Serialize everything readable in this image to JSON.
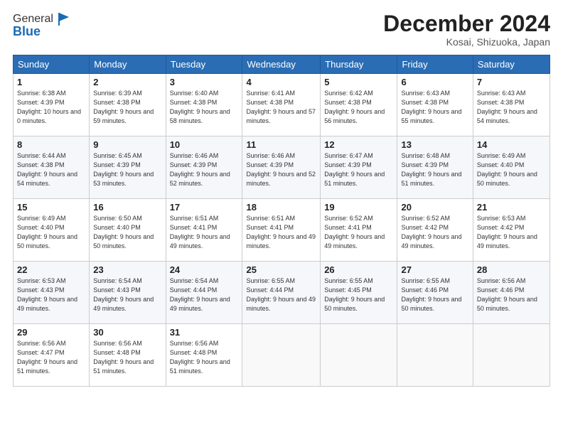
{
  "header": {
    "logo_general": "General",
    "logo_blue": "Blue",
    "month_title": "December 2024",
    "location": "Kosai, Shizuoka, Japan"
  },
  "days_of_week": [
    "Sunday",
    "Monday",
    "Tuesday",
    "Wednesday",
    "Thursday",
    "Friday",
    "Saturday"
  ],
  "weeks": [
    [
      {
        "day": "1",
        "sunrise": "6:38 AM",
        "sunset": "4:39 PM",
        "daylight": "10 hours and 0 minutes."
      },
      {
        "day": "2",
        "sunrise": "6:39 AM",
        "sunset": "4:38 PM",
        "daylight": "9 hours and 59 minutes."
      },
      {
        "day": "3",
        "sunrise": "6:40 AM",
        "sunset": "4:38 PM",
        "daylight": "9 hours and 58 minutes."
      },
      {
        "day": "4",
        "sunrise": "6:41 AM",
        "sunset": "4:38 PM",
        "daylight": "9 hours and 57 minutes."
      },
      {
        "day": "5",
        "sunrise": "6:42 AM",
        "sunset": "4:38 PM",
        "daylight": "9 hours and 56 minutes."
      },
      {
        "day": "6",
        "sunrise": "6:43 AM",
        "sunset": "4:38 PM",
        "daylight": "9 hours and 55 minutes."
      },
      {
        "day": "7",
        "sunrise": "6:43 AM",
        "sunset": "4:38 PM",
        "daylight": "9 hours and 54 minutes."
      }
    ],
    [
      {
        "day": "8",
        "sunrise": "6:44 AM",
        "sunset": "4:38 PM",
        "daylight": "9 hours and 54 minutes."
      },
      {
        "day": "9",
        "sunrise": "6:45 AM",
        "sunset": "4:39 PM",
        "daylight": "9 hours and 53 minutes."
      },
      {
        "day": "10",
        "sunrise": "6:46 AM",
        "sunset": "4:39 PM",
        "daylight": "9 hours and 52 minutes."
      },
      {
        "day": "11",
        "sunrise": "6:46 AM",
        "sunset": "4:39 PM",
        "daylight": "9 hours and 52 minutes."
      },
      {
        "day": "12",
        "sunrise": "6:47 AM",
        "sunset": "4:39 PM",
        "daylight": "9 hours and 51 minutes."
      },
      {
        "day": "13",
        "sunrise": "6:48 AM",
        "sunset": "4:39 PM",
        "daylight": "9 hours and 51 minutes."
      },
      {
        "day": "14",
        "sunrise": "6:49 AM",
        "sunset": "4:40 PM",
        "daylight": "9 hours and 50 minutes."
      }
    ],
    [
      {
        "day": "15",
        "sunrise": "6:49 AM",
        "sunset": "4:40 PM",
        "daylight": "9 hours and 50 minutes."
      },
      {
        "day": "16",
        "sunrise": "6:50 AM",
        "sunset": "4:40 PM",
        "daylight": "9 hours and 50 minutes."
      },
      {
        "day": "17",
        "sunrise": "6:51 AM",
        "sunset": "4:41 PM",
        "daylight": "9 hours and 49 minutes."
      },
      {
        "day": "18",
        "sunrise": "6:51 AM",
        "sunset": "4:41 PM",
        "daylight": "9 hours and 49 minutes."
      },
      {
        "day": "19",
        "sunrise": "6:52 AM",
        "sunset": "4:41 PM",
        "daylight": "9 hours and 49 minutes."
      },
      {
        "day": "20",
        "sunrise": "6:52 AM",
        "sunset": "4:42 PM",
        "daylight": "9 hours and 49 minutes."
      },
      {
        "day": "21",
        "sunrise": "6:53 AM",
        "sunset": "4:42 PM",
        "daylight": "9 hours and 49 minutes."
      }
    ],
    [
      {
        "day": "22",
        "sunrise": "6:53 AM",
        "sunset": "4:43 PM",
        "daylight": "9 hours and 49 minutes."
      },
      {
        "day": "23",
        "sunrise": "6:54 AM",
        "sunset": "4:43 PM",
        "daylight": "9 hours and 49 minutes."
      },
      {
        "day": "24",
        "sunrise": "6:54 AM",
        "sunset": "4:44 PM",
        "daylight": "9 hours and 49 minutes."
      },
      {
        "day": "25",
        "sunrise": "6:55 AM",
        "sunset": "4:44 PM",
        "daylight": "9 hours and 49 minutes."
      },
      {
        "day": "26",
        "sunrise": "6:55 AM",
        "sunset": "4:45 PM",
        "daylight": "9 hours and 50 minutes."
      },
      {
        "day": "27",
        "sunrise": "6:55 AM",
        "sunset": "4:46 PM",
        "daylight": "9 hours and 50 minutes."
      },
      {
        "day": "28",
        "sunrise": "6:56 AM",
        "sunset": "4:46 PM",
        "daylight": "9 hours and 50 minutes."
      }
    ],
    [
      {
        "day": "29",
        "sunrise": "6:56 AM",
        "sunset": "4:47 PM",
        "daylight": "9 hours and 51 minutes."
      },
      {
        "day": "30",
        "sunrise": "6:56 AM",
        "sunset": "4:48 PM",
        "daylight": "9 hours and 51 minutes."
      },
      {
        "day": "31",
        "sunrise": "6:56 AM",
        "sunset": "4:48 PM",
        "daylight": "9 hours and 51 minutes."
      },
      null,
      null,
      null,
      null
    ]
  ],
  "labels": {
    "sunrise": "Sunrise: ",
    "sunset": "Sunset: ",
    "daylight": "Daylight: "
  }
}
